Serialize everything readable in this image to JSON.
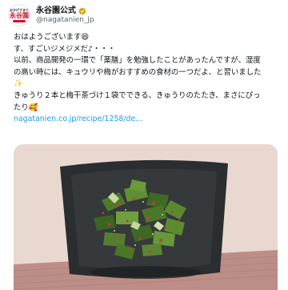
{
  "account": {
    "display_name": "永谷園公式",
    "handle": "@nagatanien_jp",
    "avatar_text_top": "おかげさまで",
    "avatar_text_main": "永谷園",
    "verified_color": "#d4a40c"
  },
  "post": {
    "line1": "おはようございます",
    "line1_emoji": "😆",
    "line2": "す、すごいジメジメだ♪・・・",
    "line3": "以前、商品開発の一環で「薬膳」を勉強したことがあったんですが、湿度",
    "line4": "の高い時には、キュウリや梅がおすすめの食材の一つだよ、と習いました",
    "line5_emoji": "✨",
    "line6": "きゅうり２本と梅干茶づけ１袋でできる、きゅうりのたたき、まさにぴっ",
    "line7": "たり",
    "line7_emoji": "🥰",
    "link": "nagatanien.co.jp/recipe/1258/de..."
  },
  "image": {
    "subject": "cucumber-umeboshi-tataki-dish",
    "colors": {
      "background": "#e8d7cf",
      "tablecloth": "#b98a85",
      "dish": "#2a2d2f",
      "cucumber": "#4d7a2c"
    }
  }
}
